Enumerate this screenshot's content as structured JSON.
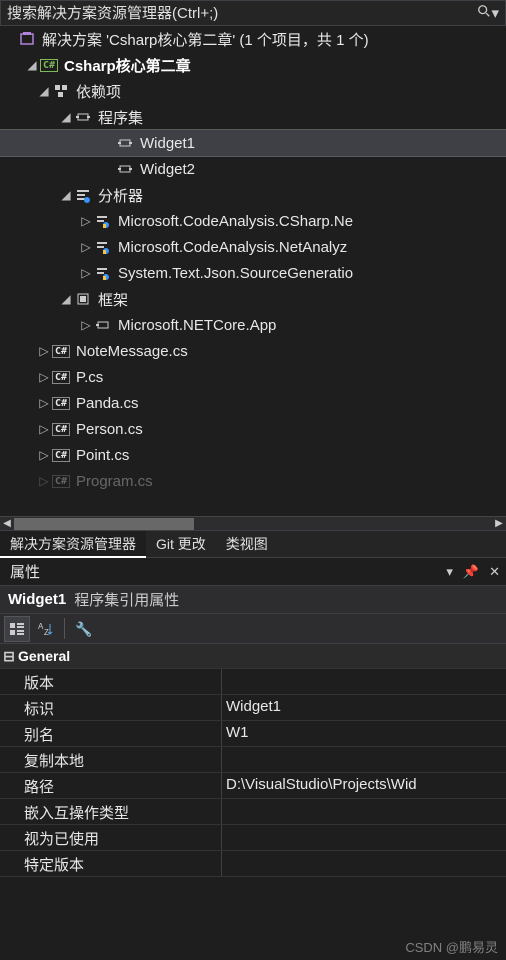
{
  "search": {
    "placeholder": "搜索解决方案资源管理器(Ctrl+;)"
  },
  "tree": {
    "solution": "解决方案 'Csharp核心第二章' (1 个项目，共 1 个)",
    "project": "Csharp核心第二章",
    "deps": "依赖项",
    "assemblies": "程序集",
    "widget1": "Widget1",
    "widget2": "Widget2",
    "analyzers": "分析器",
    "ana1": "Microsoft.CodeAnalysis.CSharp.Ne",
    "ana2": "Microsoft.CodeAnalysis.NetAnalyz",
    "ana3": "System.Text.Json.SourceGeneratio",
    "frameworks": "框架",
    "fw1": "Microsoft.NETCore.App",
    "cs1": "NoteMessage.cs",
    "cs2": "P.cs",
    "cs3": "Panda.cs",
    "cs4": "Person.cs",
    "cs5": "Point.cs",
    "cs6": "Program.cs"
  },
  "tabs": {
    "t1": "解决方案资源管理器",
    "t2": "Git 更改",
    "t3": "类视图"
  },
  "props": {
    "title": "属性",
    "item": "Widget1",
    "type": "程序集引用属性",
    "category": "General",
    "rows": [
      {
        "label": "版本",
        "value": ""
      },
      {
        "label": "标识",
        "value": "Widget1"
      },
      {
        "label": "别名",
        "value": "W1"
      },
      {
        "label": "复制本地",
        "value": ""
      },
      {
        "label": "路径",
        "value": "D:\\VisualStudio\\Projects\\Wid"
      },
      {
        "label": "嵌入互操作类型",
        "value": ""
      },
      {
        "label": "视为已使用",
        "value": ""
      },
      {
        "label": "特定版本",
        "value": ""
      }
    ]
  },
  "watermark": "CSDN @鹏易灵"
}
